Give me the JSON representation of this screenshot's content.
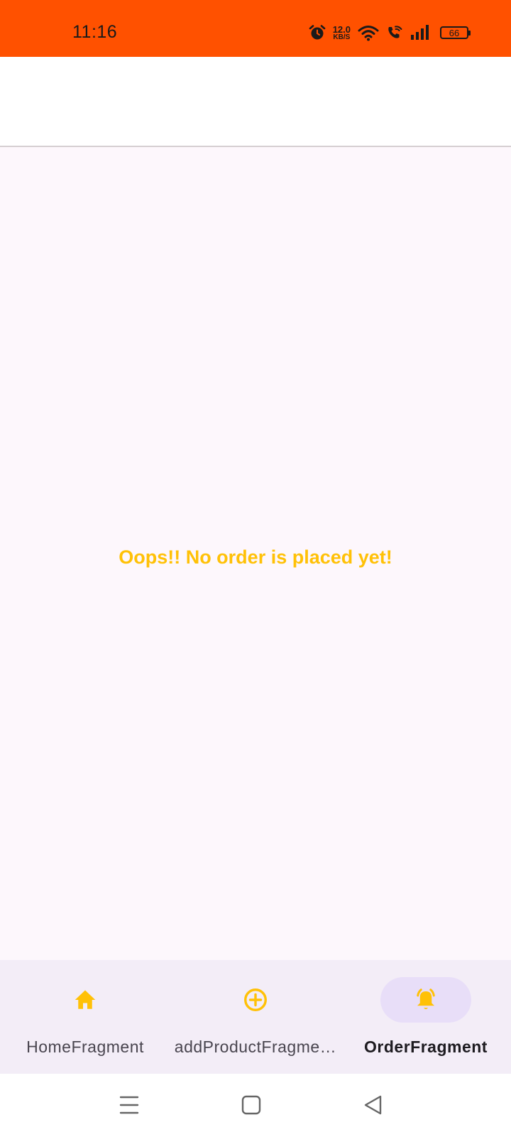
{
  "status_bar": {
    "time": "11:16",
    "net_speed_value": "12.0",
    "net_speed_unit": "KB/S",
    "battery_level": "66",
    "icons": [
      "alarm-icon",
      "wifi-icon",
      "wifi-call-icon",
      "signal-icon",
      "battery-icon"
    ],
    "background_color": "#FF5100"
  },
  "main": {
    "empty_message": "Oops!! No order is placed yet!",
    "message_color": "#FFC107"
  },
  "bottom_nav": {
    "items": [
      {
        "label": "HomeFragment",
        "icon": "home-icon",
        "active": false
      },
      {
        "label": "addProductFragme…",
        "icon": "add-circle-icon",
        "active": false
      },
      {
        "label": "OrderFragment",
        "icon": "bell-icon",
        "active": true
      }
    ],
    "icon_color": "#FFC107"
  },
  "system_nav": {
    "buttons": [
      "menu-icon",
      "home-square-icon",
      "back-triangle-icon"
    ]
  }
}
